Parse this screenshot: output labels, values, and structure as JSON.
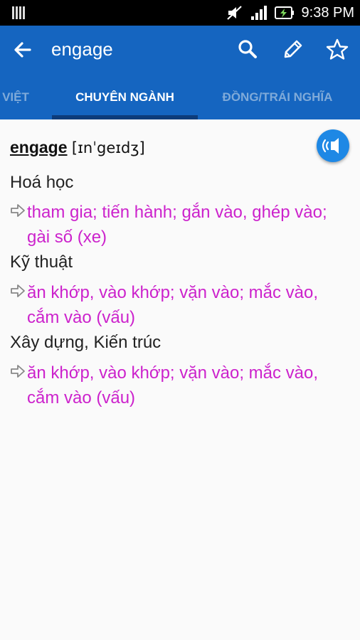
{
  "status": {
    "time": "9:38 PM"
  },
  "header": {
    "title": "engage"
  },
  "tabs": [
    {
      "label": "VIỆT"
    },
    {
      "label": "CHUYÊN NGÀNH"
    },
    {
      "label": "ĐỒNG/TRÁI NGHĨA"
    }
  ],
  "entry": {
    "word": "engage",
    "pronunciation": "[ɪnˈgeɪdʒ]",
    "sections": [
      {
        "category": "Hoá học",
        "definition": "tham gia; tiến hành; gắn vào, ghép vào; gài số (xe)"
      },
      {
        "category": "Kỹ thuật",
        "definition": "ăn khớp, vào khớp; vặn vào; mắc vào, cắm vào (vấu)"
      },
      {
        "category": "Xây dựng, Kiến trúc",
        "definition": "ăn khớp, vào khớp; vặn vào; mắc vào, cắm vào (vấu)"
      }
    ]
  },
  "colors": {
    "app_bar": "#1565c0",
    "definition": "#cc22cc",
    "speaker": "#1e88e5"
  }
}
